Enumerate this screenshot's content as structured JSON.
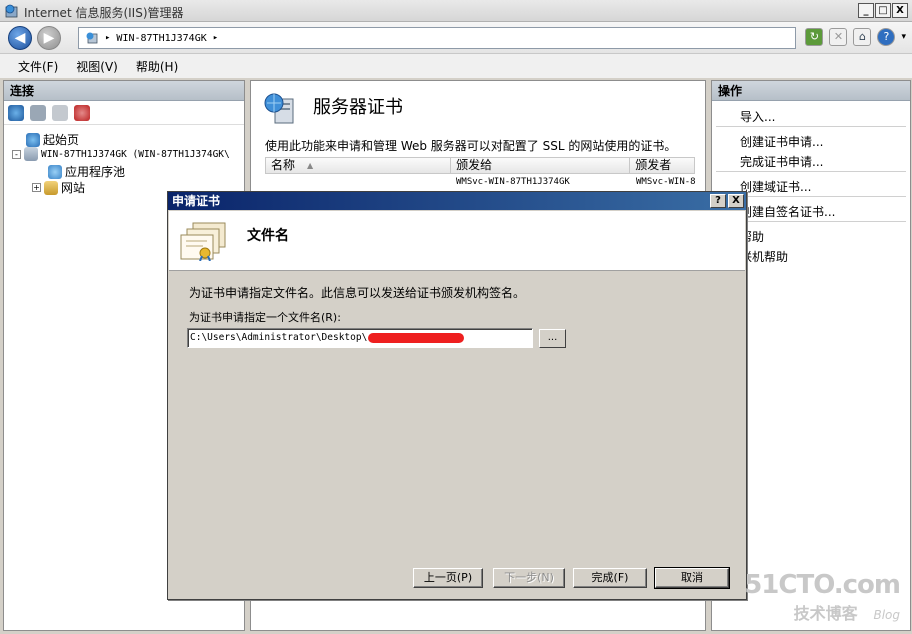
{
  "window": {
    "title": "Internet 信息服务(IIS)管理器",
    "ctrl_min": "_",
    "ctrl_max": "□",
    "ctrl_close": "X"
  },
  "address": {
    "server": "WIN-87TH1J374GK",
    "sep1": "▸",
    "sep2": "▸"
  },
  "menu": {
    "file": "文件(F)",
    "view": "视图(V)",
    "help": "帮助(H)"
  },
  "left_pane": {
    "header": "连接",
    "tree": {
      "start_page": "起始页",
      "server": "WIN-87TH1J374GK (WIN-87TH1J374GK\\",
      "app_pools": "应用程序池",
      "sites": "网站",
      "expander_minus": "-",
      "expander_plus": "+"
    }
  },
  "center_pane": {
    "title": "服务器证书",
    "description": "使用此功能来申请和管理 Web 服务器可以对配置了 SSL 的网站使用的证书。",
    "columns": [
      "名称",
      "颁发给",
      "颁发者"
    ],
    "sort_arrow": "▲",
    "rows": [
      {
        "name": "",
        "issued_to": "WMSvc-WIN-87TH1J374GK",
        "issued_by": "WMSvc-WIN-8"
      }
    ]
  },
  "right_pane": {
    "header": "操作",
    "actions": [
      "导入...",
      "创建证书申请...",
      "完成证书申请...",
      "创建域证书...",
      "创建自签名证书...",
      "帮助",
      "联机帮助"
    ]
  },
  "dialog": {
    "title": "申请证书",
    "help_btn": "?",
    "close_btn": "X",
    "banner_title": "文件名",
    "body_text": "为证书申请指定文件名。此信息可以发送给证书颁发机构签名。",
    "field_label": "为证书申请指定一个文件名(R):",
    "field_value": "C:\\Users\\Administrator\\Desktop\\",
    "browse_label": "...",
    "buttons": {
      "prev": "上一页(P)",
      "next": "下一步(N)",
      "finish": "完成(F)",
      "cancel": "取消"
    }
  },
  "watermark": {
    "line1": "51CTO.com",
    "line2": "技术博客",
    "line3": "Blog"
  },
  "colors": {
    "dialog_title_start": "#0a246a",
    "dialog_title_end": "#3a6ea5",
    "redaction": "#ee1f1f"
  }
}
